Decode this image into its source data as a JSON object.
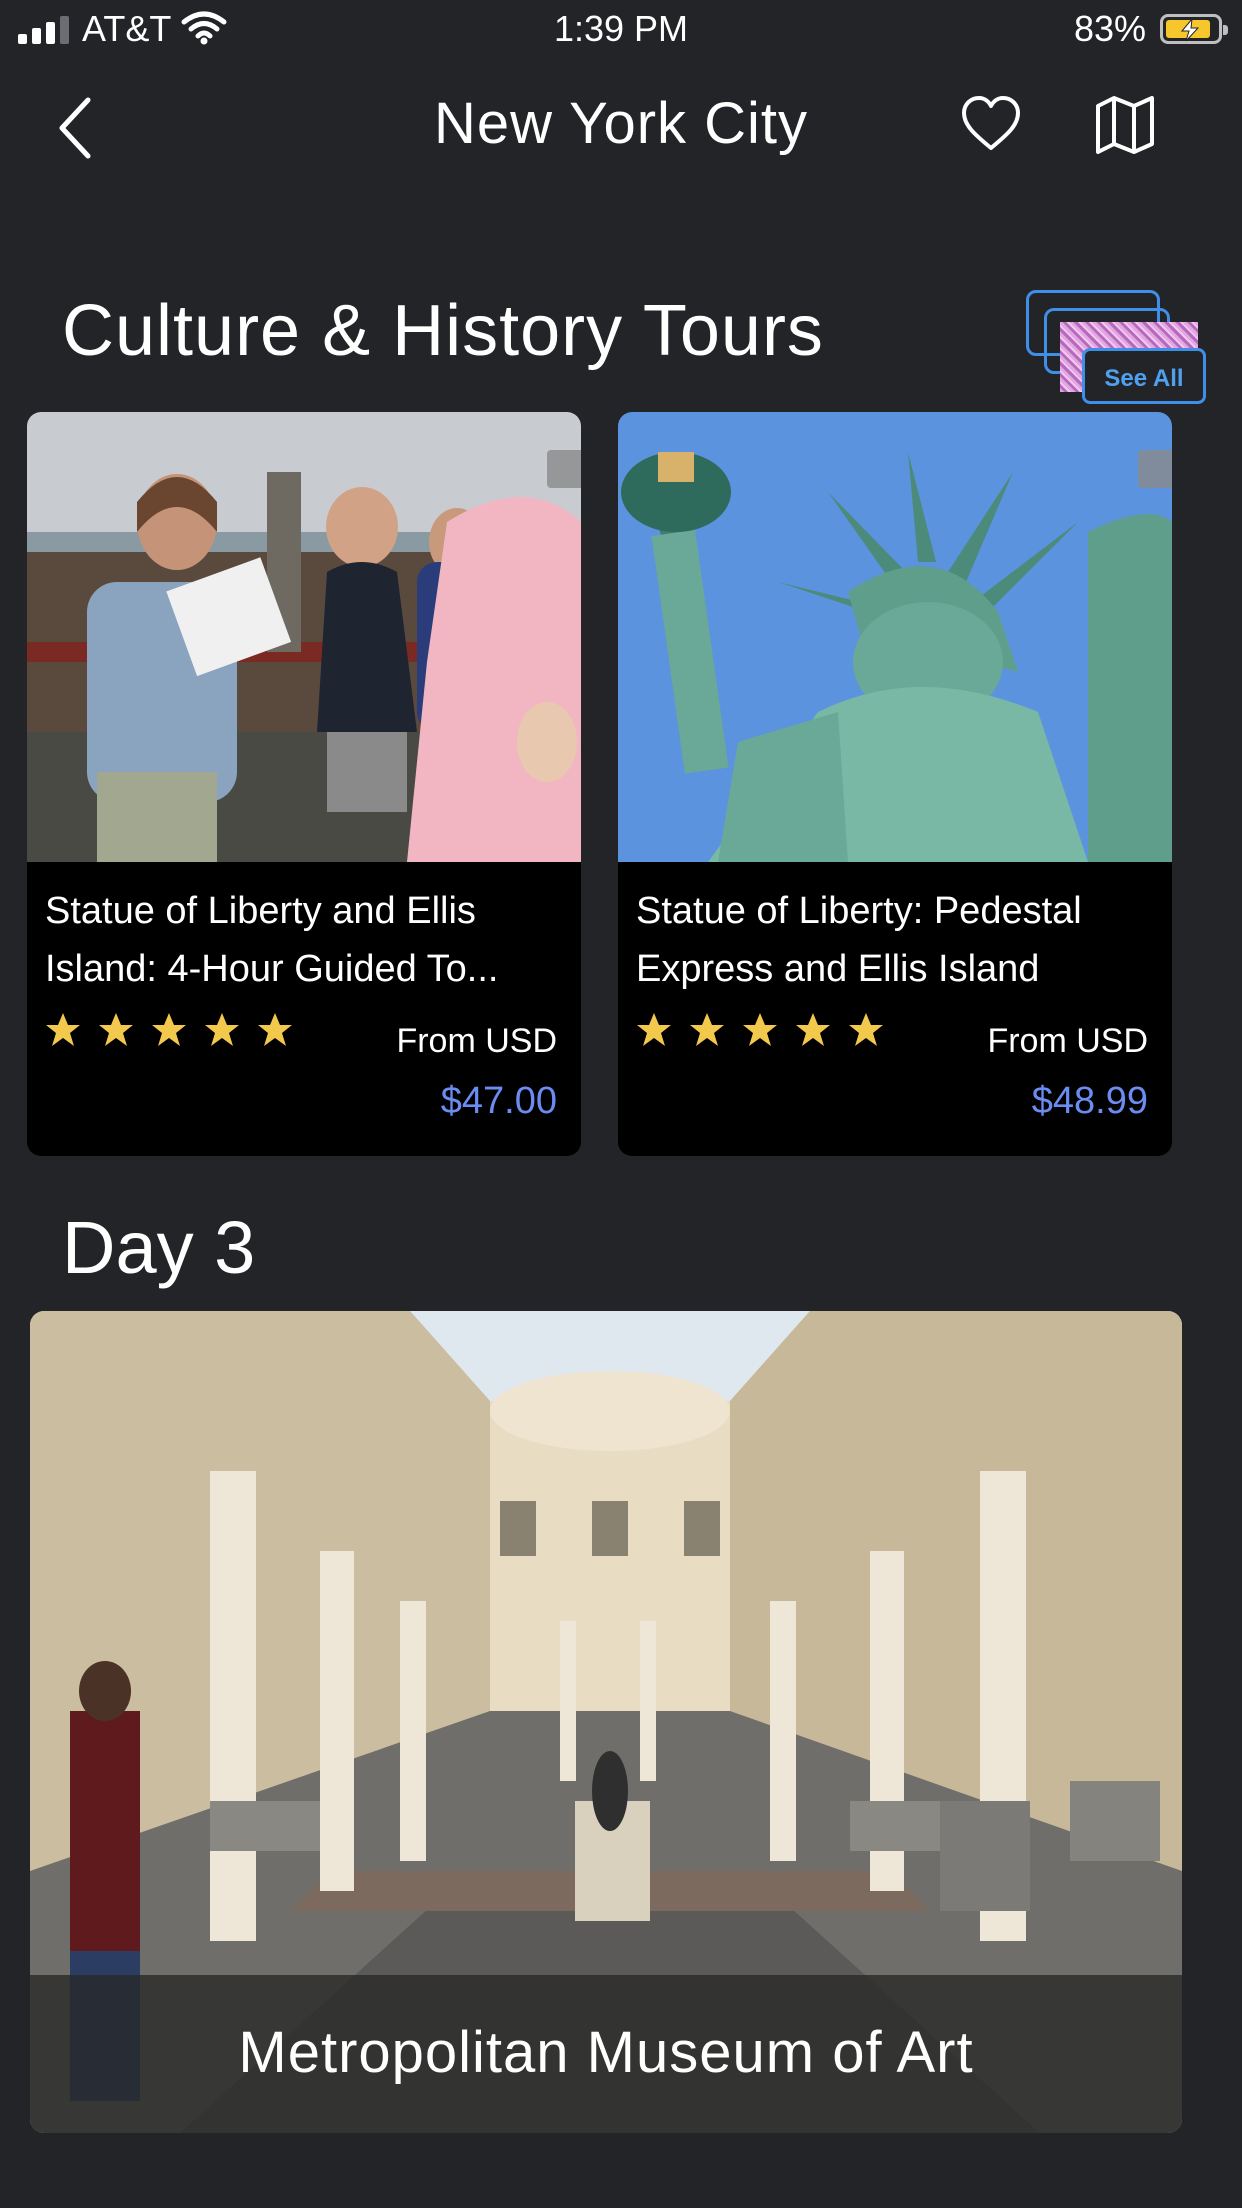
{
  "status_bar": {
    "carrier": "AT&T",
    "time": "1:39 PM",
    "battery": "83%"
  },
  "nav": {
    "title": "New York City"
  },
  "section": {
    "title": "Culture & History Tours",
    "see_all": "See All"
  },
  "tours": [
    {
      "title": "Statue of Liberty and Ellis Island: 4-Hour Guided To...",
      "rating": 5,
      "from_label": "From USD",
      "price": "$47.00"
    },
    {
      "title": "Statue of Liberty: Pedestal Express and Ellis Island",
      "rating": 5,
      "from_label": "From USD",
      "price": "$48.99"
    }
  ],
  "day": {
    "title": "Day 3",
    "place": "Metropolitan Museum of Art"
  },
  "colors": {
    "background": "#232427",
    "price": "#6b8cf0",
    "star": "#f2c94c",
    "see_all_accent": "#3f8fe6"
  }
}
